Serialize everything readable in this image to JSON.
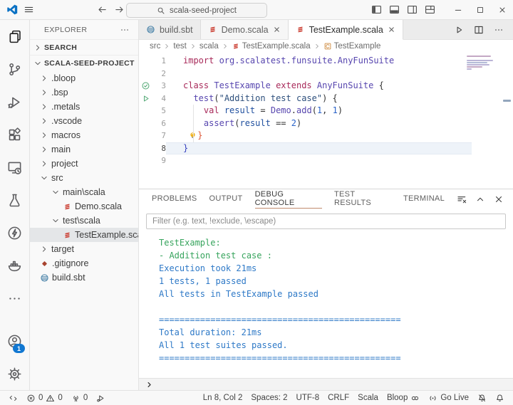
{
  "colors": {
    "vscode_blue": "#0b72c4",
    "badge_blue": "#1177d1",
    "scala_red": "#cb3e32",
    "sbt_blue": "#447fa6",
    "git_orange": "#a8432f",
    "symbol_class_orange": "#cd8a3e",
    "bulb_yellow": "#f0b21d",
    "test_green": "#4ba56f",
    "console_green": "#37a45d",
    "console_blue": "#2e79c7",
    "panel_active_tab_underline": "#c08a6e",
    "kw": "#a82a5a",
    "type": "#5746af",
    "func": "#5746af",
    "str": "#2d4f7c",
    "num": "#2a63c9",
    "var": "#1f4f9e",
    "plain": "#333333",
    "bracket_red": "#dd5636",
    "bracket_blue": "#3742bf"
  },
  "titlebar": {
    "search_value": "scala-seed-project",
    "nav_icons": [
      "arrow-left",
      "arrow-right"
    ],
    "layout_icons": [
      "layout-sidebar-left",
      "layout-panel",
      "layout-sidebar-right",
      "layout-customize"
    ],
    "window_controls": [
      "minimize",
      "maximize",
      "close"
    ]
  },
  "activity_bar": {
    "top": [
      {
        "name": "explorer",
        "icon": "files",
        "active": true
      },
      {
        "name": "source-control",
        "icon": "source-control"
      },
      {
        "name": "run-and-debug",
        "icon": "run-debug"
      },
      {
        "name": "extensions",
        "icon": "extensions"
      },
      {
        "name": "remote-explorer",
        "icon": "remote"
      },
      {
        "name": "testing",
        "icon": "beaker"
      },
      {
        "name": "metals",
        "icon": "lightning"
      },
      {
        "name": "docker",
        "icon": "docker"
      },
      {
        "name": "more-views",
        "icon": "ellipsis"
      }
    ],
    "bottom": [
      {
        "name": "accounts",
        "icon": "account",
        "badge": "1"
      },
      {
        "name": "settings",
        "icon": "gear"
      }
    ]
  },
  "explorer": {
    "title": "EXPLORER",
    "sections": [
      {
        "label": "SEARCH",
        "state": "collapsed"
      },
      {
        "label": "SCALA-SEED-PROJECT",
        "state": "expanded"
      }
    ],
    "tree": [
      {
        "label": ".bloop",
        "level": 1,
        "kind": "folder",
        "state": "collapsed"
      },
      {
        "label": ".bsp",
        "level": 1,
        "kind": "folder",
        "state": "collapsed"
      },
      {
        "label": ".metals",
        "level": 1,
        "kind": "folder",
        "state": "collapsed"
      },
      {
        "label": ".vscode",
        "level": 1,
        "kind": "folder",
        "state": "collapsed"
      },
      {
        "label": "macros",
        "level": 1,
        "kind": "folder",
        "state": "collapsed"
      },
      {
        "label": "main",
        "level": 1,
        "kind": "folder",
        "state": "collapsed"
      },
      {
        "label": "project",
        "level": 1,
        "kind": "folder",
        "state": "collapsed"
      },
      {
        "label": "src",
        "level": 1,
        "kind": "folder",
        "state": "expanded"
      },
      {
        "label": "main\\scala",
        "level": 2,
        "kind": "folder",
        "state": "expanded"
      },
      {
        "label": "Demo.scala",
        "level": 3,
        "kind": "file",
        "icon": "scala"
      },
      {
        "label": "test\\scala",
        "level": 2,
        "kind": "folder",
        "state": "expanded"
      },
      {
        "label": "TestExample.scala",
        "level": 3,
        "kind": "file",
        "icon": "scala",
        "selected": true
      },
      {
        "label": "target",
        "level": 1,
        "kind": "folder",
        "state": "collapsed"
      },
      {
        "label": ".gitignore",
        "level": 1,
        "kind": "file",
        "icon": "git"
      },
      {
        "label": "build.sbt",
        "level": 1,
        "kind": "file",
        "icon": "sbt"
      }
    ]
  },
  "editor": {
    "tabs": [
      {
        "label": "build.sbt",
        "icon": "sbt",
        "closable": false
      },
      {
        "label": "Demo.scala",
        "icon": "scala",
        "closable": true,
        "light": true
      },
      {
        "label": "TestExample.scala",
        "icon": "scala",
        "closable": true,
        "active": true
      }
    ],
    "tab_actions": [
      "run",
      "split-editor",
      "ellipsis"
    ],
    "breadcrumb": [
      {
        "label": "src"
      },
      {
        "label": "test"
      },
      {
        "label": "scala"
      },
      {
        "label": "TestExample.scala",
        "icon": "scala"
      },
      {
        "label": "TestExample",
        "icon": "class-symbol"
      }
    ],
    "lines": [
      {
        "num": 1,
        "tokens": [
          {
            "t": "import ",
            "c": "kw"
          },
          {
            "t": "org.scalatest.funsuite.AnyFunSuite",
            "c": "type"
          }
        ]
      },
      {
        "num": 2,
        "tokens": []
      },
      {
        "num": 3,
        "marker": "test-passed",
        "tokens": [
          {
            "t": "class ",
            "c": "kw"
          },
          {
            "t": "TestExample",
            "c": "type"
          },
          {
            "t": " extends ",
            "c": "kw"
          },
          {
            "t": "AnyFunSuite",
            "c": "type"
          },
          {
            "t": " {",
            "c": "plain"
          }
        ]
      },
      {
        "num": 4,
        "marker": "test-run",
        "tokens": [
          {
            "t": "  ",
            "c": "plain"
          },
          {
            "t": "test",
            "c": "func"
          },
          {
            "t": "(",
            "c": "plain"
          },
          {
            "t": "\"Addition test case\"",
            "c": "str"
          },
          {
            "t": ") {",
            "c": "plain"
          }
        ]
      },
      {
        "num": 5,
        "tokens": [
          {
            "t": "    ",
            "c": "plain"
          },
          {
            "t": "val ",
            "c": "kw"
          },
          {
            "t": "result",
            "c": "var"
          },
          {
            "t": " = ",
            "c": "plain"
          },
          {
            "t": "Demo",
            "c": "type"
          },
          {
            "t": ".",
            "c": "plain"
          },
          {
            "t": "add",
            "c": "func"
          },
          {
            "t": "(",
            "c": "plain"
          },
          {
            "t": "1",
            "c": "num"
          },
          {
            "t": ", ",
            "c": "plain"
          },
          {
            "t": "1",
            "c": "num"
          },
          {
            "t": ")",
            "c": "plain"
          }
        ]
      },
      {
        "num": 6,
        "tokens": [
          {
            "t": "    ",
            "c": "plain"
          },
          {
            "t": "assert",
            "c": "func"
          },
          {
            "t": "(",
            "c": "plain"
          },
          {
            "t": "result",
            "c": "var"
          },
          {
            "t": " == ",
            "c": "plain"
          },
          {
            "t": "2",
            "c": "num"
          },
          {
            "t": ")",
            "c": "plain"
          }
        ]
      },
      {
        "num": 7,
        "tokens": [
          {
            "t": " ",
            "c": "plain"
          },
          {
            "icon": "lightbulb"
          },
          {
            "t": "}",
            "c": "bracket-red"
          }
        ]
      },
      {
        "num": 8,
        "current": true,
        "tokens": [
          {
            "t": "}",
            "c": "bracket-blue"
          }
        ]
      },
      {
        "num": 9,
        "tokens": []
      }
    ]
  },
  "panel": {
    "tabs": [
      {
        "label": "PROBLEMS"
      },
      {
        "label": "OUTPUT"
      },
      {
        "label": "DEBUG CONSOLE",
        "active": true
      },
      {
        "label": "TEST RESULTS"
      },
      {
        "label": "TERMINAL"
      }
    ],
    "actions": [
      "clear-console",
      "chevron-up",
      "close"
    ],
    "filter_placeholder": "Filter (e.g. text, !exclude, \\escape)",
    "console": [
      {
        "text": "TestExample:",
        "color": "green"
      },
      {
        "text": "- Addition test case :",
        "color": "green"
      },
      {
        "text": "Execution took 21ms",
        "color": "blue"
      },
      {
        "text": "1 tests, 1 passed",
        "color": "blue"
      },
      {
        "text": "All tests in TestExample passed",
        "color": "blue"
      },
      {
        "text": "",
        "color": "blue"
      },
      {
        "text": "===============================================",
        "color": "blue"
      },
      {
        "text": "Total duration: 21ms",
        "color": "blue"
      },
      {
        "text": "All 1 test suites passed.",
        "color": "blue"
      },
      {
        "text": "===============================================",
        "color": "blue"
      }
    ]
  },
  "statusbar": {
    "left": [
      {
        "name": "remote",
        "icon": "remote-indicator"
      },
      {
        "name": "problems",
        "segments": [
          {
            "icon": "error-circle",
            "text": "0"
          },
          {
            "icon": "warning-triangle",
            "text": "0"
          }
        ]
      },
      {
        "name": "ports",
        "segments": [
          {
            "icon": "radio-tower",
            "text": "0"
          }
        ]
      },
      {
        "name": "debug",
        "icon": "debug-alt"
      }
    ],
    "right": [
      {
        "name": "cursor-position",
        "text": "Ln 8, Col 2"
      },
      {
        "name": "indentation",
        "text": "Spaces: 2"
      },
      {
        "name": "encoding",
        "text": "UTF-8"
      },
      {
        "name": "eol",
        "text": "CRLF"
      },
      {
        "name": "language",
        "text": "Scala"
      },
      {
        "name": "bloop",
        "text": "Bloop",
        "icon_after": "link"
      },
      {
        "name": "go-live",
        "icon": "broadcast",
        "text": "Go Live"
      },
      {
        "name": "do-not-disturb",
        "icon": "bell-slash"
      },
      {
        "name": "notifications",
        "icon": "bell"
      }
    ]
  }
}
